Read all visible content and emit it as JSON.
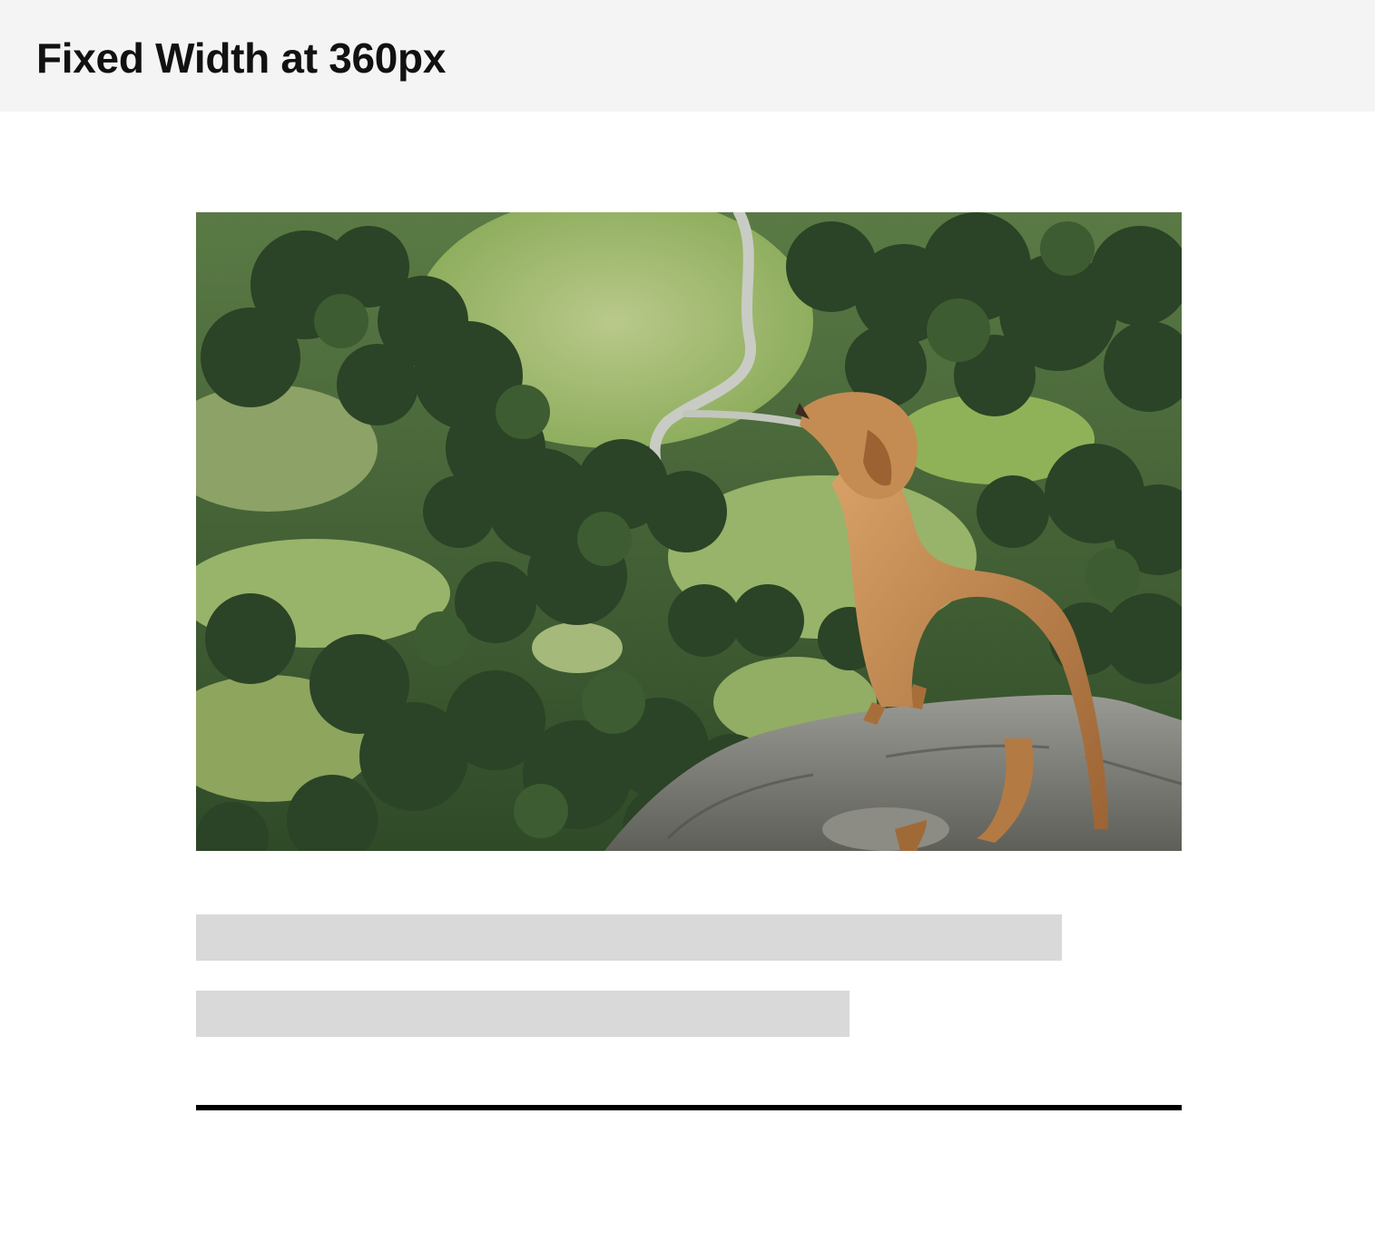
{
  "header": {
    "title": "Fixed Width at 360px"
  },
  "card": {
    "image_subject": "dog-on-rock-overlooking-valley-photo",
    "skeleton_lines": 2
  },
  "colors": {
    "header_background": "#f4f4f4",
    "skeleton": "#d9d9d9",
    "divider": "#000000"
  }
}
